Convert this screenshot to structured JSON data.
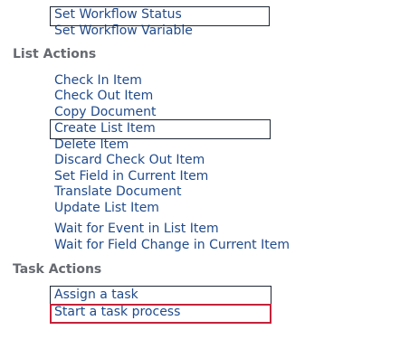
{
  "sections": [
    {
      "header": "",
      "items": [
        "Set Workflow Status",
        "Set Workflow Variable"
      ]
    },
    {
      "header": "List Actions",
      "items": [
        "Check In Item",
        "Check Out Item",
        "Copy Document",
        "Create List Item",
        "Delete Item",
        "Discard Check Out Item",
        "Set Field in Current Item",
        "Translate Document",
        "Update List Item",
        "Wait for Event in List Item",
        "Wait for Field Change in Current Item"
      ]
    },
    {
      "header": "Task Actions",
      "items": [
        "Assign a task",
        "Start a task process"
      ]
    }
  ],
  "highlight_colors": {
    "box": "#1d2633",
    "selected_box": "#c4223a"
  }
}
